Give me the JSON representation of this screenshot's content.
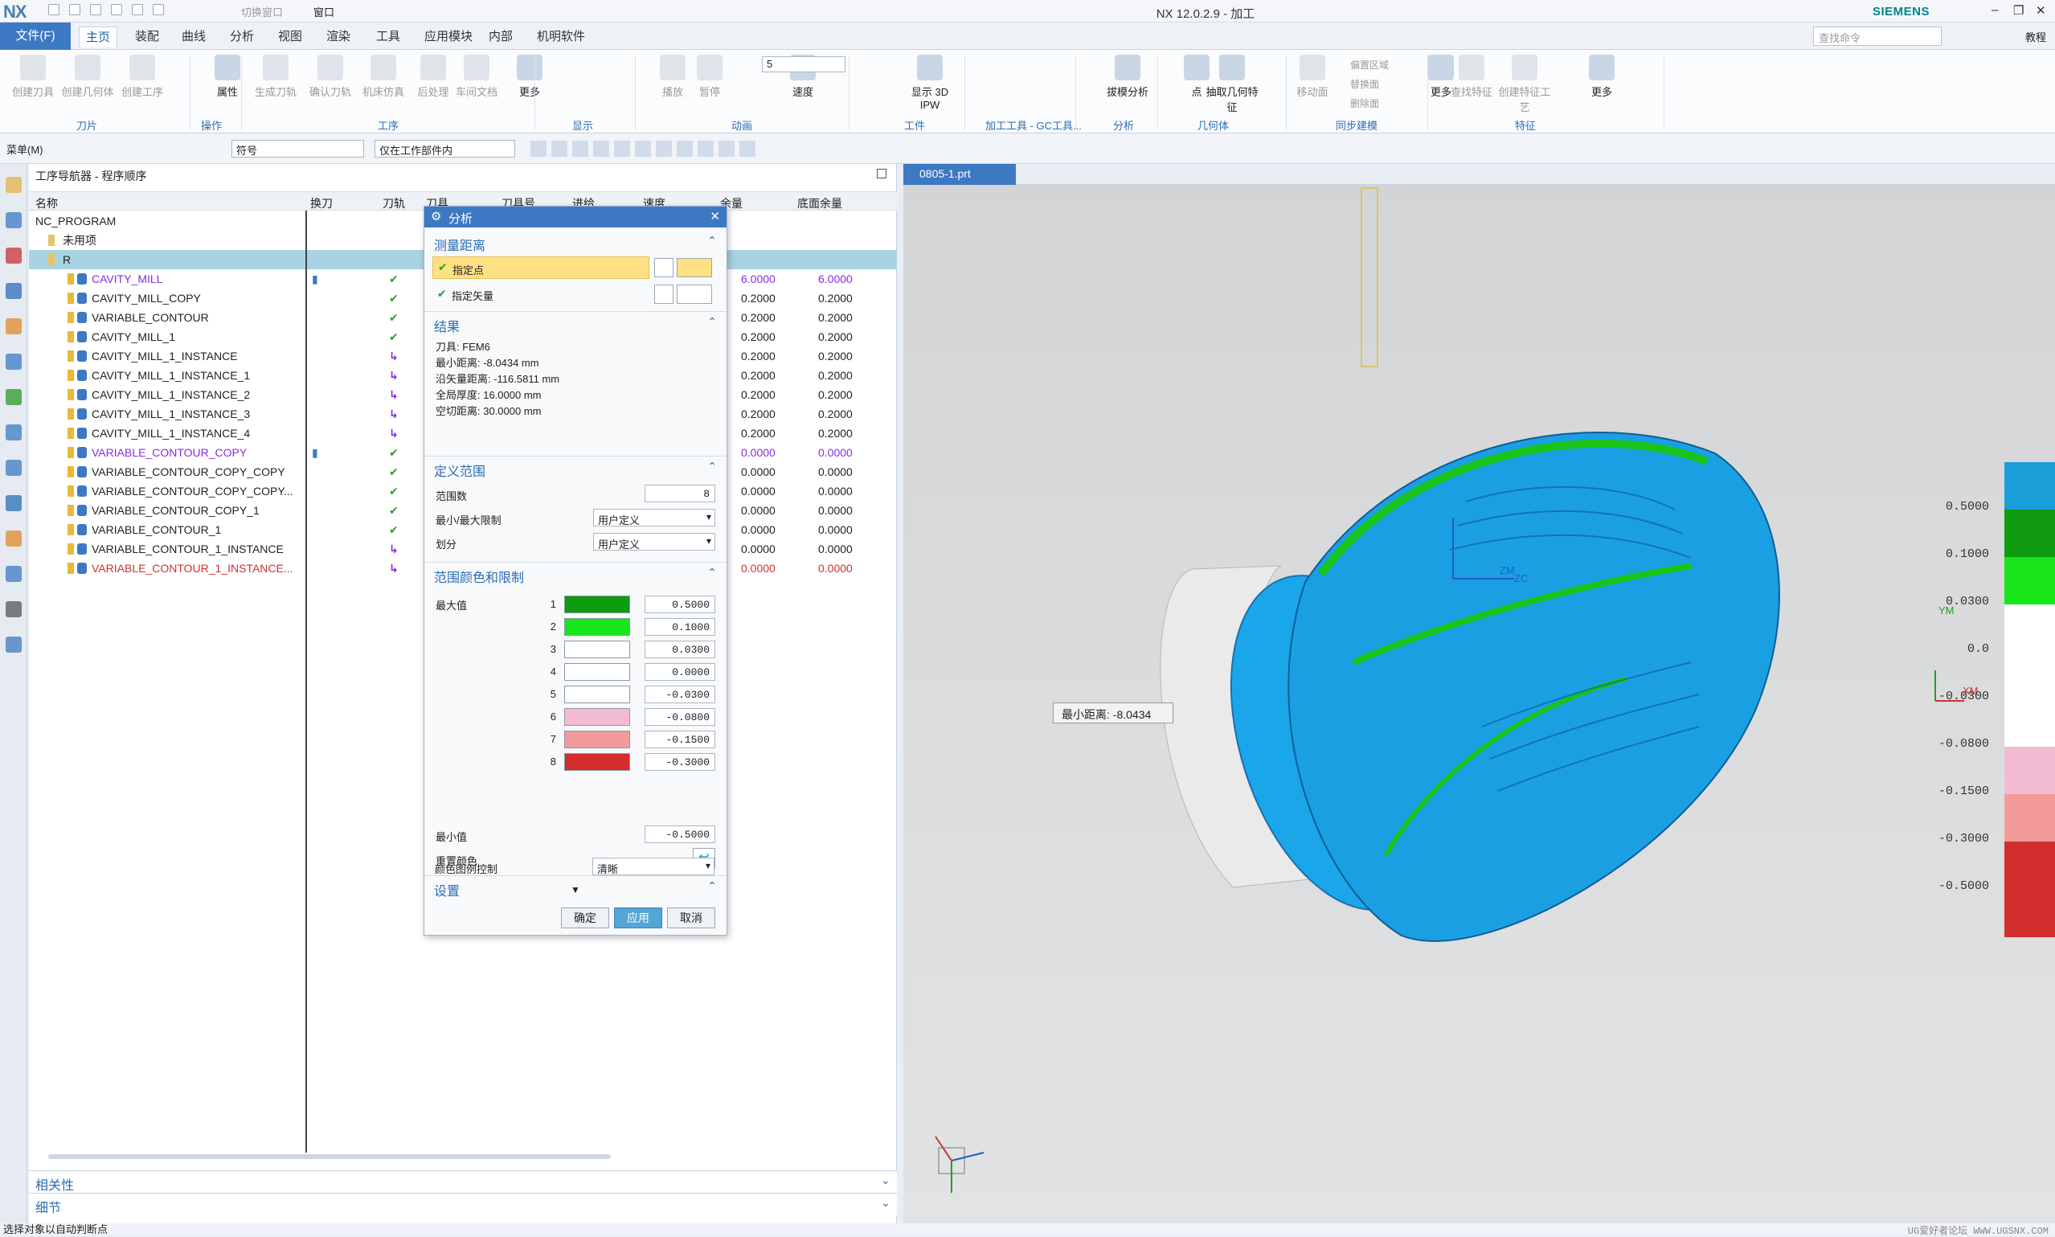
{
  "app": {
    "logo": "NX",
    "title": "NX 12.0.2.9 - 加工",
    "brand": "SIEMENS",
    "quick_access": {
      "switch_window": "切换窗口",
      "window_menu": "窗口"
    }
  },
  "menu": {
    "file": "文件(F)",
    "tabs": [
      "主页",
      "装配",
      "曲线",
      "分析",
      "视图",
      "渲染",
      "工具",
      "应用模块",
      "内部",
      "机明软件"
    ],
    "search_placeholder": "查找命令",
    "tutorial": "教程"
  },
  "ribbon": {
    "buttons": [
      {
        "label": "创建刀具",
        "on": false
      },
      {
        "label": "创建几何体",
        "on": false
      },
      {
        "label": "创建工序",
        "on": false
      },
      {
        "label": "属性",
        "on": true
      },
      {
        "label": "生成刀轨",
        "on": false
      },
      {
        "label": "确认刀轨",
        "on": false
      },
      {
        "label": "机床仿真",
        "on": false
      },
      {
        "label": "后处理",
        "on": false
      },
      {
        "label": "车间文档",
        "on": false
      },
      {
        "label": "更多",
        "on": true
      },
      {
        "label": "播放",
        "on": false
      },
      {
        "label": "暂停",
        "on": false
      },
      {
        "label": "速度",
        "on": true
      },
      {
        "label": "显示 3D IPW",
        "on": true
      },
      {
        "label": "拔模分析",
        "on": true
      },
      {
        "label": "点",
        "on": true
      },
      {
        "label": "抽取几何特征",
        "on": true
      },
      {
        "label": "移动面",
        "on": false
      },
      {
        "label": "更多",
        "on": true
      },
      {
        "label": "查找特征",
        "on": false
      },
      {
        "label": "创建特征工艺",
        "on": false
      },
      {
        "label": "更多",
        "on": true
      }
    ],
    "small": {
      "offset_region": "偏置区域",
      "replace_face": "替换面",
      "delete_face": "删除面",
      "speed_value": "5"
    },
    "groups": [
      "刀片",
      "操作",
      "工序",
      "显示",
      "动画",
      "工件",
      "加工工具 - GC工具...",
      "分析",
      "几何体",
      "同步建模",
      "特征"
    ]
  },
  "toolbar2": {
    "menu": "菜单(M)",
    "filter": "符号",
    "scope": "仅在工作部件内"
  },
  "navigator": {
    "title": "工序导航器 - 程序顺序",
    "columns": [
      "名称",
      "换刀",
      "刀轨",
      "刀具",
      "刀具号",
      "进给",
      "速度",
      "余量",
      "底面余量"
    ],
    "rows": [
      {
        "name": "NC_PROGRAM",
        "level": 0,
        "color": "#222",
        "tool_change": "",
        "path": "",
        "stock": "",
        "floor": ""
      },
      {
        "name": "未用项",
        "level": 1,
        "color": "#222",
        "tool_change": "",
        "path": "",
        "stock": "",
        "floor": ""
      },
      {
        "name": "R",
        "level": 1,
        "color": "#222",
        "tool_change": "",
        "path": "",
        "stock": "",
        "floor": "",
        "selected": true
      },
      {
        "name": "CAVITY_MILL",
        "level": 2,
        "color": "#8a2be2",
        "tool_change": "▮",
        "path": "✔",
        "stock": "6.0000",
        "floor": "6.0000",
        "vcolor": "#8a2be2"
      },
      {
        "name": "CAVITY_MILL_COPY",
        "level": 2,
        "color": "#222",
        "tool_change": "",
        "path": "✔",
        "stock": "0.2000",
        "floor": "0.2000"
      },
      {
        "name": "VARIABLE_CONTOUR",
        "level": 2,
        "color": "#222",
        "tool_change": "",
        "path": "✔",
        "stock": "0.2000",
        "floor": "0.2000"
      },
      {
        "name": "CAVITY_MILL_1",
        "level": 2,
        "color": "#222",
        "tool_change": "",
        "path": "✔",
        "stock": "0.2000",
        "floor": "0.2000"
      },
      {
        "name": "CAVITY_MILL_1_INSTANCE",
        "level": 2,
        "color": "#222",
        "tool_change": "",
        "path": "↳",
        "stock": "0.2000",
        "floor": "0.2000"
      },
      {
        "name": "CAVITY_MILL_1_INSTANCE_1",
        "level": 2,
        "color": "#222",
        "tool_change": "",
        "path": "↳",
        "stock": "0.2000",
        "floor": "0.2000"
      },
      {
        "name": "CAVITY_MILL_1_INSTANCE_2",
        "level": 2,
        "color": "#222",
        "tool_change": "",
        "path": "↳",
        "stock": "0.2000",
        "floor": "0.2000"
      },
      {
        "name": "CAVITY_MILL_1_INSTANCE_3",
        "level": 2,
        "color": "#222",
        "tool_change": "",
        "path": "↳",
        "stock": "0.2000",
        "floor": "0.2000"
      },
      {
        "name": "CAVITY_MILL_1_INSTANCE_4",
        "level": 2,
        "color": "#222",
        "tool_change": "",
        "path": "↳",
        "stock": "0.2000",
        "floor": "0.2000"
      },
      {
        "name": "VARIABLE_CONTOUR_COPY",
        "level": 2,
        "color": "#8a2be2",
        "tool_change": "▮",
        "path": "✔",
        "stock": "0.0000",
        "floor": "0.0000",
        "vcolor": "#8a2be2"
      },
      {
        "name": "VARIABLE_CONTOUR_COPY_COPY",
        "level": 2,
        "color": "#222",
        "tool_change": "",
        "path": "✔",
        "stock": "0.0000",
        "floor": "0.0000"
      },
      {
        "name": "VARIABLE_CONTOUR_COPY_COPY...",
        "level": 2,
        "color": "#222",
        "tool_change": "",
        "path": "✔",
        "stock": "0.0000",
        "floor": "0.0000"
      },
      {
        "name": "VARIABLE_CONTOUR_COPY_1",
        "level": 2,
        "color": "#222",
        "tool_change": "",
        "path": "✔",
        "stock": "0.0000",
        "floor": "0.0000"
      },
      {
        "name": "VARIABLE_CONTOUR_1",
        "level": 2,
        "color": "#222",
        "tool_change": "",
        "path": "✔",
        "stock": "0.0000",
        "floor": "0.0000"
      },
      {
        "name": "VARIABLE_CONTOUR_1_INSTANCE",
        "level": 2,
        "color": "#222",
        "tool_change": "",
        "path": "↳",
        "stock": "0.0000",
        "floor": "0.0000"
      },
      {
        "name": "VARIABLE_CONTOUR_1_INSTANCE...",
        "level": 2,
        "color": "#d32f2f",
        "tool_change": "",
        "path": "↳",
        "stock": "0.0000",
        "floor": "0.0000",
        "vcolor": "#d32f2f"
      }
    ],
    "footer": [
      "相关性",
      "细节"
    ]
  },
  "dialog": {
    "title": "分析",
    "sec_measure": "测量距离",
    "specify_point": "指定点",
    "specify_vector": "指定矢量",
    "sec_result": "结果",
    "results": [
      "刀具: FEM6",
      "最小距离: -8.0434 mm",
      "沿矢量距离: -116.5811 mm",
      "全局厚度: 16.0000 mm",
      "空切距离: 30.0000 mm"
    ],
    "sec_range": "定义范围",
    "range_count_label": "范围数",
    "range_count": "8",
    "minmax_label": "最小/最大限制",
    "minmax_value": "用户定义",
    "divide_label": "划分",
    "divide_value": "用户定义",
    "sec_colors": "范围颜色和限制",
    "max_label": "最大值",
    "min_label": "最小值",
    "min_value": "-0.5000",
    "levels": [
      {
        "i": "1",
        "color": "#0f9a10",
        "value": "0.5000"
      },
      {
        "i": "2",
        "color": "#18e61a",
        "value": "0.1000"
      },
      {
        "i": "3",
        "color": "#ffffff",
        "value": "0.0300"
      },
      {
        "i": "4",
        "color": "#ffffff",
        "value": "0.0000"
      },
      {
        "i": "5",
        "color": "#ffffff",
        "value": "-0.0300"
      },
      {
        "i": "6",
        "color": "#f4bcd2",
        "value": "-0.0800"
      },
      {
        "i": "7",
        "color": "#f39a9a",
        "value": "-0.1500"
      },
      {
        "i": "8",
        "color": "#d42d2d",
        "value": "-0.3000"
      }
    ],
    "reset_colors": "重置颜色",
    "sec_settings": "设置",
    "legend_ctrl_label": "颜色图例控制",
    "legend_ctrl_value": "清晰",
    "ok": "确定",
    "apply": "应用",
    "cancel": "取消"
  },
  "viewport": {
    "tab": "0805-1.prt",
    "min_distance_label": "最小距离: -8.0434",
    "legend": [
      {
        "color": "#1a9ed8",
        "value": ""
      },
      {
        "color": "#0f9a10",
        "value": "0.5000"
      },
      {
        "color": "#18e61a",
        "value": "0.1000"
      },
      {
        "color": "#ffffff",
        "value": "0.0300"
      },
      {
        "color": "#ffffff",
        "value": "0.0"
      },
      {
        "color": "#ffffff",
        "value": "-0.0300"
      },
      {
        "color": "#f4bcd2",
        "value": "-0.0800"
      },
      {
        "color": "#f39a9a",
        "value": "-0.1500"
      },
      {
        "color": "#d42d2d",
        "value": "-0.3000"
      },
      {
        "color": "#d42d2d",
        "value": "-0.5000"
      }
    ],
    "axes": {
      "zc": "ZC",
      "zm": "ZM",
      "ym": "YM",
      "xm": "XM"
    }
  },
  "status": {
    "text": "选择对象以自动判断点",
    "watermark": "UG爱好者论坛 WWW.UGSNX.COM"
  }
}
